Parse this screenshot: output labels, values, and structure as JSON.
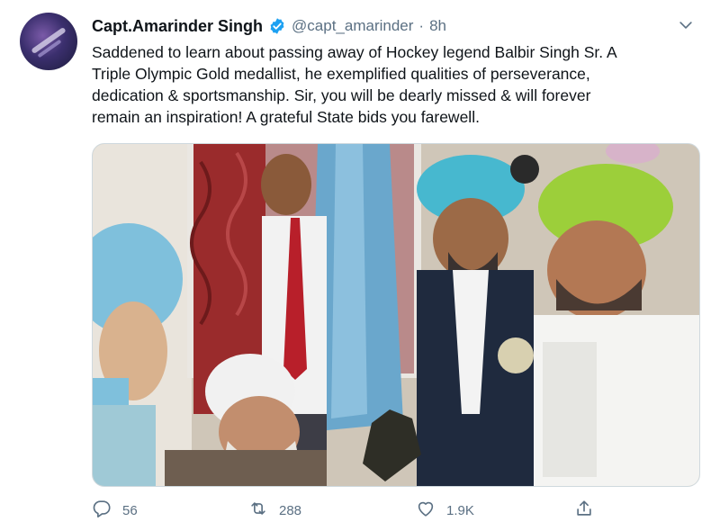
{
  "tweet": {
    "author_name": "Capt.Amarinder Singh",
    "handle": "@capt_amarinder",
    "separator": "·",
    "time": "8h",
    "text_lines": [
      "Saddened to learn about passing away of Hockey legend Balbir Singh Sr. A",
      "Triple Olympic Gold medallist, he exemplified qualities of perseverance,",
      "dedication & sportsmanship. Sir, you will be dearly missed & will forever",
      "remain an inspiration! A grateful State bids you farewell."
    ]
  },
  "actions": {
    "replies": "56",
    "retweets": "288",
    "likes": "1.9K"
  },
  "icons": {
    "verified": "verified-badge-icon",
    "menu": "chevron-down-icon",
    "reply": "reply-icon",
    "retweet": "retweet-icon",
    "like": "heart-icon",
    "share": "share-icon"
  },
  "colors": {
    "verified_blue": "#1da1f2",
    "secondary_text": "#5b7083"
  }
}
